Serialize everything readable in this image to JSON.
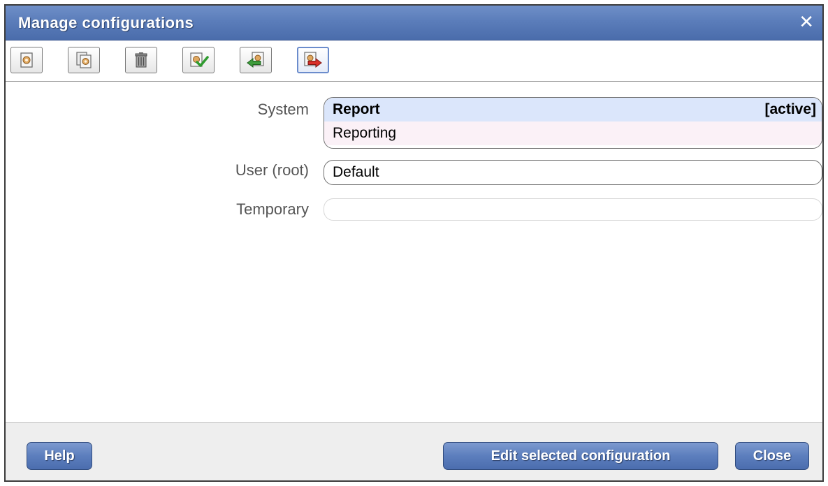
{
  "window": {
    "title": "Manage configurations",
    "close_glyph": "✕"
  },
  "toolbar": {
    "buttons": [
      {
        "icon": "new-configuration-icon"
      },
      {
        "icon": "copy-configuration-icon"
      },
      {
        "icon": "trash-icon"
      },
      {
        "icon": "activate-checkmark-icon"
      },
      {
        "icon": "import-arrow-icon"
      },
      {
        "icon": "export-arrow-icon",
        "selected": true
      }
    ]
  },
  "sections": {
    "system": {
      "label": "System",
      "items": [
        {
          "name": "Report",
          "status": "[active]"
        },
        {
          "name": "Reporting",
          "status": ""
        }
      ]
    },
    "user": {
      "label": "User (root)",
      "items": [
        {
          "name": "Default"
        }
      ]
    },
    "temporary": {
      "label": "Temporary",
      "items": []
    }
  },
  "footer": {
    "help_label": "Help",
    "edit_label": "Edit selected configuration",
    "close_label": "Close"
  },
  "colors": {
    "title_bar": "#5b7dba",
    "active_row": "#dbe6fb",
    "alt_row": "#fbf1f7",
    "button_blue": "#5c7ebd",
    "export_arrow": "#d9302a",
    "import_arrow": "#3f9c3c"
  }
}
